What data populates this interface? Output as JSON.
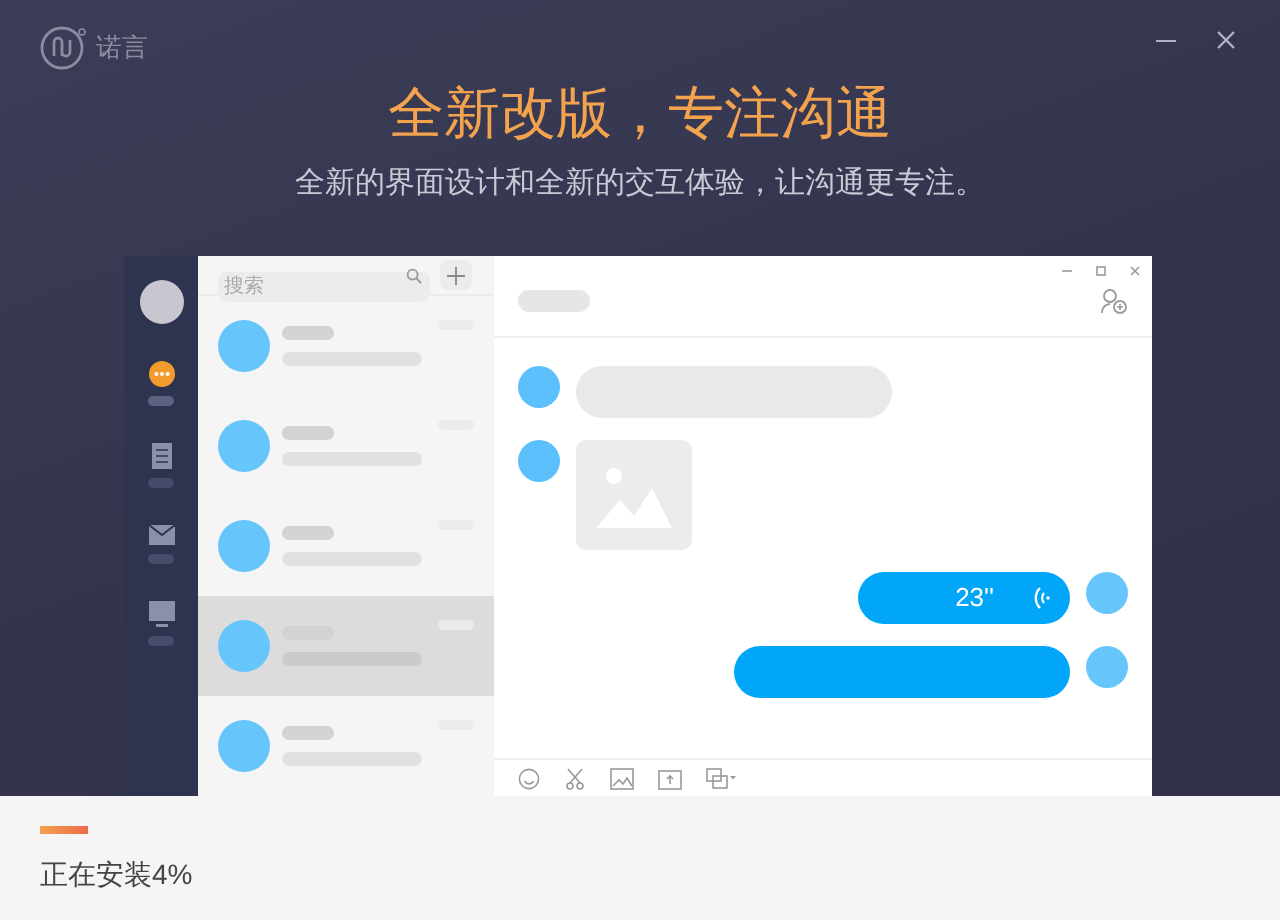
{
  "logo": {
    "text": "诺言"
  },
  "headline": "全新改版，专注沟通",
  "subheadline": "全新的界面设计和全新的交互体验，让沟通更专注。",
  "preview": {
    "sidebar": [
      {
        "kind": "chat",
        "selected": true
      },
      {
        "kind": "contacts",
        "selected": false
      },
      {
        "kind": "mail",
        "selected": false
      },
      {
        "kind": "desktop",
        "selected": false
      }
    ],
    "search": {
      "placeholder": "搜索"
    },
    "conversations": [
      {
        "selected": false
      },
      {
        "selected": false
      },
      {
        "selected": false
      },
      {
        "selected": true
      },
      {
        "selected": false
      }
    ],
    "messages": [
      {
        "kind": "text",
        "outgoing": false
      },
      {
        "kind": "image",
        "outgoing": false
      },
      {
        "kind": "voice",
        "outgoing": true,
        "duration": "23''"
      },
      {
        "kind": "text",
        "outgoing": true
      }
    ]
  },
  "progress": {
    "level": 0.04,
    "label": "正在安装4%"
  }
}
